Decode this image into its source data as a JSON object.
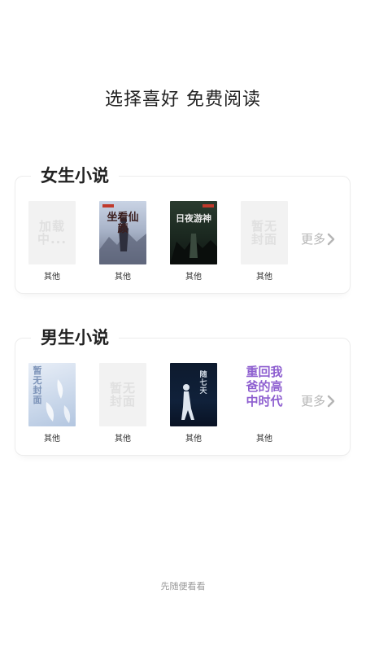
{
  "headline": "选择喜好 免费阅读",
  "female": {
    "title": "女生小说",
    "more_label": "更多",
    "books": [
      {
        "category": "其他",
        "cover_text": "加载中..."
      },
      {
        "category": "其他",
        "cover_text": "坐看仙颜"
      },
      {
        "category": "其他",
        "cover_text": "日夜游神"
      },
      {
        "category": "其他",
        "cover_text": "暂无封面"
      }
    ]
  },
  "male": {
    "title": "男生小说",
    "more_label": "更多",
    "books": [
      {
        "category": "其他",
        "cover_text": "暂无封面"
      },
      {
        "category": "其他",
        "cover_text": "暂无封面"
      },
      {
        "category": "其他",
        "cover_text": "随七天"
      },
      {
        "category": "其他",
        "cover_text": "重回我爸的高中时代"
      }
    ]
  },
  "footer": {
    "skip_label": "先随便看看"
  },
  "colors": {
    "text_primary": "#222222",
    "text_muted": "#999999",
    "more": "#b5b5b5",
    "card_border": "#ececec",
    "placeholder_bg": "#f2f2f2"
  }
}
